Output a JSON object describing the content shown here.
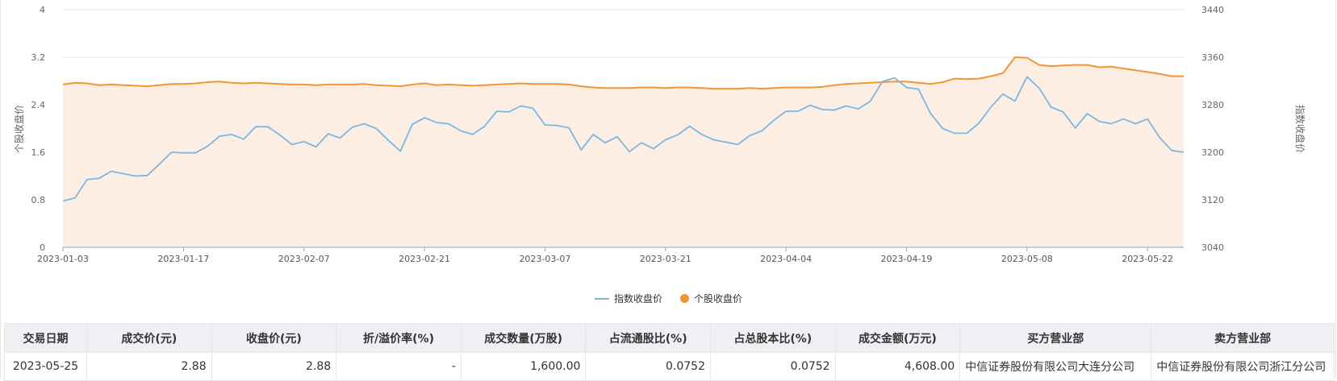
{
  "colors": {
    "index": "#7ab8e2",
    "stock": "#f39533",
    "area": "#fdeee3",
    "grid": "#e6e6e6"
  },
  "chart_data": {
    "type": "line",
    "x_ticks": [
      "2023-01-03",
      "2023-01-17",
      "2023-02-07",
      "2023-02-21",
      "2023-03-07",
      "2023-03-21",
      "2023-04-04",
      "2023-04-19",
      "2023-05-08",
      "2023-05-22"
    ],
    "y_left": {
      "label": "个股收盘价",
      "ticks": [
        "0",
        "0.8",
        "1.6",
        "2.4",
        "3.2",
        "4"
      ],
      "range": [
        0,
        4
      ]
    },
    "y_right": {
      "label": "指数收盘价",
      "ticks": [
        "3040",
        "3120",
        "3200",
        "3280",
        "3360",
        "3440"
      ],
      "range": [
        3040,
        3440
      ]
    },
    "legend": [
      "指数收盘价",
      "个股收盘价"
    ],
    "series": [
      {
        "name": "指数收盘价",
        "axis": "right",
        "values": [
          3118,
          3123,
          3154,
          3156,
          3168,
          3164,
          3160,
          3161,
          3180,
          3200,
          3199,
          3199,
          3210,
          3227,
          3230,
          3222,
          3243,
          3243,
          3229,
          3213,
          3218,
          3209,
          3231,
          3224,
          3242,
          3248,
          3240,
          3220,
          3202,
          3247,
          3258,
          3250,
          3248,
          3236,
          3230,
          3244,
          3269,
          3268,
          3278,
          3274,
          3246,
          3245,
          3241,
          3204,
          3230,
          3216,
          3226,
          3201,
          3216,
          3206,
          3221,
          3229,
          3244,
          3230,
          3221,
          3217,
          3213,
          3228,
          3236,
          3254,
          3269,
          3269,
          3279,
          3272,
          3271,
          3278,
          3273,
          3286,
          3319,
          3325,
          3309,
          3306,
          3265,
          3240,
          3232,
          3232,
          3249,
          3276,
          3298,
          3286,
          3327,
          3308,
          3276,
          3268,
          3241,
          3265,
          3252,
          3248,
          3256,
          3248,
          3256,
          3225,
          3203,
          3200
        ]
      },
      {
        "name": "个股收盘价",
        "axis": "left",
        "values": [
          2.74,
          2.77,
          2.76,
          2.73,
          2.74,
          2.73,
          2.72,
          2.71,
          2.73,
          2.75,
          2.75,
          2.76,
          2.78,
          2.79,
          2.77,
          2.76,
          2.77,
          2.76,
          2.75,
          2.74,
          2.74,
          2.73,
          2.74,
          2.74,
          2.74,
          2.75,
          2.73,
          2.72,
          2.71,
          2.74,
          2.76,
          2.73,
          2.74,
          2.73,
          2.72,
          2.73,
          2.74,
          2.75,
          2.76,
          2.75,
          2.75,
          2.75,
          2.74,
          2.71,
          2.69,
          2.68,
          2.68,
          2.68,
          2.69,
          2.69,
          2.68,
          2.69,
          2.69,
          2.68,
          2.67,
          2.67,
          2.67,
          2.68,
          2.67,
          2.68,
          2.69,
          2.69,
          2.69,
          2.7,
          2.73,
          2.75,
          2.76,
          2.77,
          2.78,
          2.79,
          2.79,
          2.77,
          2.75,
          2.78,
          2.84,
          2.83,
          2.84,
          2.88,
          2.93,
          3.2,
          3.19,
          3.07,
          3.05,
          3.06,
          3.07,
          3.07,
          3.03,
          3.04,
          3.01,
          2.98,
          2.95,
          2.92,
          2.88,
          2.88
        ]
      }
    ]
  },
  "table": {
    "headers": [
      "交易日期",
      "成交价(元)",
      "收盘价(元)",
      "折/溢价率(%)",
      "成交数量(万股)",
      "占流通股比(%)",
      "占总股本比(%)",
      "成交金额(万元)",
      "买方营业部",
      "卖方营业部"
    ],
    "rows": [
      [
        "2023-05-25",
        "2.88",
        "2.88",
        "-",
        "1,600.00",
        "0.0752",
        "0.0752",
        "4,608.00",
        "中信证券股份有限公司大连分公司",
        "中信证券股份有限公司浙江分公司"
      ]
    ]
  }
}
